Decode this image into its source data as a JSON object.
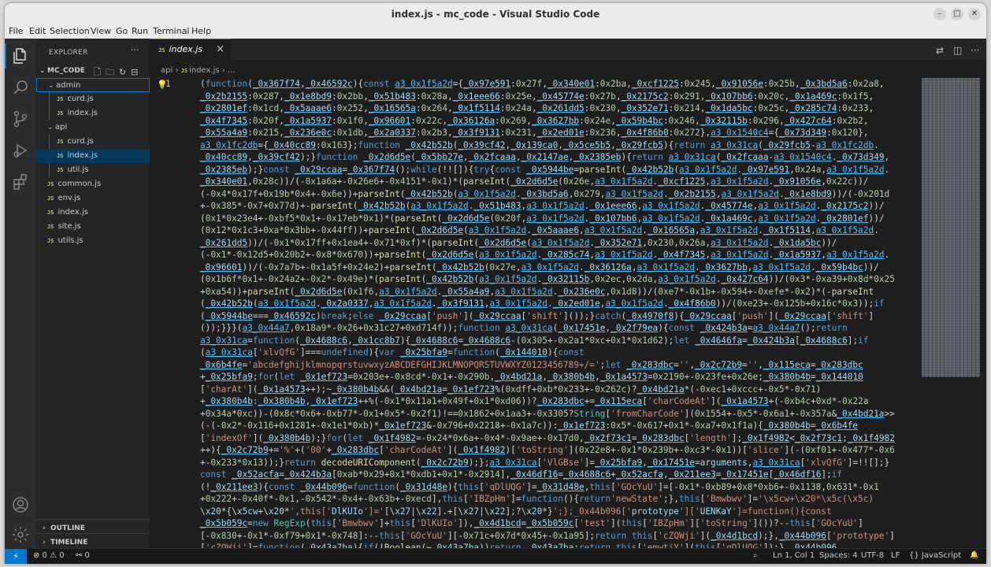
{
  "window": {
    "title": "index.js - mc_code - Visual Studio Code"
  },
  "menu": [
    "File",
    "Edit",
    "Selection",
    "View",
    "Go",
    "Run",
    "Terminal",
    "Help"
  ],
  "explorer": {
    "header": "EXPLORER",
    "more": "···",
    "root": "MC_CODE",
    "items": [
      {
        "label": "admin",
        "type": "folder"
      },
      {
        "label": "curd.js",
        "type": "file"
      },
      {
        "label": "index.js",
        "type": "file"
      },
      {
        "label": "api",
        "type": "folder"
      },
      {
        "label": "curd.js",
        "type": "file"
      },
      {
        "label": "index.js",
        "type": "file"
      },
      {
        "label": "util.js",
        "type": "file"
      },
      {
        "label": "common.js",
        "type": "file"
      },
      {
        "label": "env.js",
        "type": "file"
      },
      {
        "label": "index.js",
        "type": "file"
      },
      {
        "label": "site.js",
        "type": "file"
      },
      {
        "label": "utils.js",
        "type": "file"
      }
    ],
    "outline": "OUTLINE",
    "timeline": "TIMELINE"
  },
  "editor": {
    "tab": {
      "badge": "JS",
      "label": "index.js",
      "close": "×"
    },
    "breadcrumb": {
      "folder": "api",
      "sep": "›",
      "badge": "JS",
      "file": "index.js",
      "sep2": "›",
      "tail": "..."
    },
    "line_number": "1",
    "code_lines": [
      "(function(_0x367f74,_0x46592c){const a3_0x1f5a2d={_0x97e591:0x27f,_0x340e01:0x2ba,_0xcf1225:0x245,_0x91056e:0x25b,_0x3bd5a6:0x2a8,",
      "_0x2b2155:0x287,_0x1e8bd9:0x2bb,_0x51b483:0x28a,_0x1eee66:0x25e,_0x45774e:0x27b,_0x2175c2:0x291,_0x107bb6:0x20c,_0x1a469c:0x1f5,",
      "_0x2801ef:0x1cd,_0x5aaae6:0x252,_0x16565a:0x264,_0x1f5114:0x24a,_0x261dd5:0x230,_0x352e71:0x214,_0x1da5bc:0x25c,_0x285c74:0x233,",
      "_0x4f7345:0x20f,_0x1a5937:0x1f0,_0x96601:0x22c,_0x36126a:0x269,_0x3627bb:0x24e,_0x59b4bc:0x246,_0x32115b:0x296,_0x427c64:0x2b2,",
      "_0x55a4a9:0x215,_0x236e0c:0x1db,_0x2a0337:0x2b3,_0x3f9131:0x231,_0x2ed01e:0x236,_0x4f86b0:0x272},a3_0x1540c4={_0x73d349:0x120},",
      "a3_0x1fc2db={_0x40cc89:0x163};function _0x42b52b(_0x39cf42,_0x139ca0,_0x5ce5b5,_0x29fcb5){return a3_0x31ca(_0x29fcb5-a3_0x1fc2db.",
      "_0x40cc89,_0x39cf42);}function _0x2d6d5e(_0x5bb27e,_0x2fcaaa,_0x2147ae,_0x2385eb){return a3_0x31ca(_0x2fcaaa-a3_0x1540c4._0x73d349,",
      "_0x2385eb);}const _0x29ccaa=_0x367f74();while(!![]){try{const _0x5944be=parseInt(_0x42b52b(a3_0x1f5a2d._0x97e591,0x24a,a3_0x1f5a2d.",
      "_0x340e01,0x28c))/(-0x1a6a+-0x26e6+-0x4151*-0x1)*(parseInt(_0x2d6d5e(0x26e,a3_0x1f5a2d._0xcf1225,a3_0x1f5a2d._0x91056e,0x22c))/",
      "(-0x4*0x17f+0x19b*0x4+-0x6e))+parseInt(_0x42b52b(a3_0x1f5a2d._0x3bd5a6,0x279,a3_0x1f5a2d._0x2b2155,a3_0x1f5a2d._0x1e8bd9))/(-0x201d",
      "+-0x385*-0x7+0x77d)+-parseInt(_0x42b52b(a3_0x1f5a2d._0x51b483,a3_0x1f5a2d._0x1eee66,a3_0x1f5a2d._0x45774e,a3_0x1f5a2d._0x2175c2))/",
      "(0x1*0x23e4+-0xbf5*0x1+-0x17eb*0x1)*(parseInt(_0x2d6d5e(0x20f,a3_0x1f5a2d._0x107bb6,a3_0x1f5a2d._0x1a469c,a3_0x1f5a2d._0x2801ef))/",
      "(0x12*0x1c3+0xa*0x3bb+-0x44ff))+parseInt(_0x2d6d5e(a3_0x1f5a2d._0x5aaae6,a3_0x1f5a2d._0x16565a,a3_0x1f5a2d._0x1f5114,a3_0x1f5a2d.",
      "_0x261dd5))/(-0x1*0x17ff+0x1ea4+-0x71*0xf)*(parseInt(_0x2d6d5e(a3_0x1f5a2d._0x352e71,0x230,0x26a,a3_0x1f5a2d._0x1da5bc))/",
      "(-0x1*-0x12d5+0x20b2+-0x8*0x670))+parseInt(_0x2d6d5e(a3_0x1f5a2d._0x285c74,a3_0x1f5a2d._0x4f7345,a3_0x1f5a2d._0x1a5937,a3_0x1f5a2d.",
      "_0x96601))/(-0x7a7b+-0x1a5f+0x24e2)+parseInt(_0x42b52b(0x27e,a3_0x1f5a2d._0x36126a,a3_0x1f5a2d._0x3627bb,a3_0x1f5a2d._0x59b4bc))/",
      "(0x1b6f*0x1+-0x24a2+-0x2*-0x49e)*(parseInt(_0x42b52b(a3_0x1f5a2d._0x32115b,0x2ec,0x2da,a3_0x1f5a2d._0x427c64))/(0x3*-0xa39+0x8d*0x25",
      "+0xa54))+parseInt(_0x2d6d5e(0x1f6,a3_0x1f5a2d._0x55a4a9,a3_0x1f5a2d._0x236e0c,0x1d8))/(0xe7*-0x1b+-0x594+-0xefe*-0x2)*(-parseInt",
      "(_0x42b52b(a3_0x1f5a2d._0x2a0337,a3_0x1f5a2d._0x3f9131,a3_0x1f5a2d._0x2ed01e,a3_0x1f5a2d._0x4f86b0))/(0xe23+-0x125b+0x16c*0x3));if",
      "(_0x5944be===_0x46592c)break;else _0x29ccaa['push'](_0x29ccaa['shift']());}catch(_0x4970f8){_0x29ccaa['push'](_0x29ccaa['shift']",
      "());}}}(a3_0x44a7,0x18a9*-0x26+0x31c27+0xd714f));function a3_0x31ca(_0x17451e,_0x2f79ea){const _0x424b3a=a3_0x44a7();return",
      "a3_0x31ca=function(_0x4688c6,_0x1cc8b7){_0x4688c6=_0x4688c6-(0x305+-0x2a1*0xc+0x1*0x1d62);let _0x4646fa=_0x424b3a[_0x4688c6];if",
      "(a3_0x31ca['xlvQfG']===undefined){var _0x25bfa9=function(_0x144010){const",
      "_0x6b4fe='abcdefghijklmnopqrstuvwxyzABCDEFGHIJKLMNOPQRSTUVWXYZ0123456789+/=';let _0x283dbc='',_0x2c72b9='',_0x115eca=_0x283dbc",
      "+_0x25bfa9;for(let _0x1ef723=0x203e+-0x8cd*-0x1+-0x290b,_0x4bd21a,_0x380b4b,_0x1a4573=0x2190+-0x23fe+0x26e;_0x380b4b=_0x144010",
      "['charAt'](_0x1a4573++);~_0x380b4b&&(_0x4bd21a=_0x1ef723%(0xdff+0xb*0x233+-0x262c)?_0x4bd21a*(-0xec1+0xccc+-0x5*-0x71)",
      "+_0x380b4b:_0x380b4b,_0x1ef723++%(-0x1*0x11a1+0x49f+0x1*0xd06))?_0x283dbc+=_0x115eca['charCodeAt'](_0x1a4573+(-0xb4c+0xd*-0x22a",
      "+0x34a*0xc))-(0x8c*0x6+-0xb77*-0x1+0x5*-0x2f1)!==0x1862+0x1aa3+-0x3305?String['fromCharCode'](0x1554+-0x5*-0x6a1+-0x357a&_0x4bd21a>>",
      "(-(-0x2*-0x116+0x1281+-0x1e1*0xb)*_0x1ef723&-0x796+0x2218+-0x1a7c)):_0x1ef723:0x5*-0x617+0x1*-0xa7+0x1f1a){_0x380b4b=_0x6b4fe",
      "['indexOf'](_0x380b4b);}for(let _0x1f4982=-0x24*0x6a+-0x4*-0x9ae+-0x17d0,_0x2f73c1=_0x283dbc['length'];_0x1f4982<_0x2f73c1;_0x1f4982",
      "++){_0x2c72b9+='%'+('00'+_0x283dbc['charCodeAt'](_0x1f4982)['toString'](0x22e8+-0x1*0x239b+-0xc3*-0x1))['slice'](-(0xf01+-0x477*-0x6",
      "+-0x233*0x13));}return decodeURIComponent(_0x2c72b9);};a3_0x31ca['VlGBse']=_0x25bfa9,_0x17451e=arguments,a3_0x31ca['xlvQfG']=!![];}",
      "const _0x52acfa=_0x424b3a[0xab*0x29+0x1*0xdb1+0x1*-0x2914],_0x46df16=_0x4688c6+_0x52acfa,_0x211ee3=_0x17451e[_0x46df16];if",
      "(!_0x211ee3){const _0x44b096=function(_0x31d48e){this['qDlUQG']=_0x31d48e,this['GOcYuU']=[-0x1*-0xb89+0x8*0xb6+-0x1138,0x631*-0x1",
      "+0x222+-0x40f*-0x1,-0x542*-0x4+-0x63b+-0xecd],this['IBZpHm']=function(){return'newState';},this['Bmwbwv']='\\x5cw+\\x20*\\x5c(\\x5c)",
      "\\x20*{\\x5cw+\\x20*',this['DlKUIo']='[\\x27|\\x22].+[\\x27|\\x22];?\\x20*}';};_0x44b096['prototype']['UENKaY']=function(){const",
      "_0x5b059c=new RegExp(this['Bmwbwv']+this['DlKUIo']),_0x4d1bcd=_0x5b059c['test'](this['IBZpHm']['toString']())?--this['GOcYuU']",
      "[-0x830+-0x1*-0xf79+0x1*-0x748]:--this['GOcYuU'][-0x71c+0x7d*0x45+-0x1a95];return this['cZQWji'](_0x4d1bcd);},_0x44b096['prototype']",
      "['cZQWji']=function(_0x43a7ba){if(!Boolean(~_0x43a7ba))return _0x43a7ba;return this['emwtiY'](this['qDlUQG']);},_0x44b096"
    ]
  },
  "status": {
    "errors": "⊗ 0 ⚠ 0",
    "ports": "⚯ 0",
    "zoom": "⌕",
    "position": "Ln 1, Col 1",
    "spaces": "Spaces: 4",
    "encoding": "UTF-8",
    "eol": "LF",
    "lang_icon": "{}",
    "language": "JavaScript",
    "bell": "🔔"
  }
}
